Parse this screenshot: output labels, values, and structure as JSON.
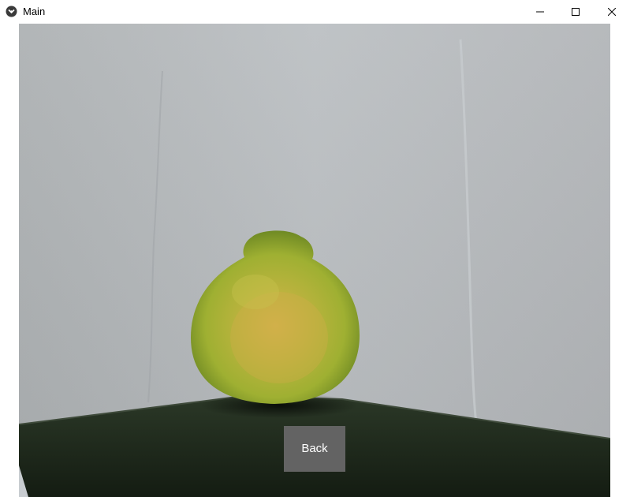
{
  "window": {
    "title": "Main",
    "icon": "kivy-app-icon",
    "controls": [
      "minimize-icon",
      "maximize-icon",
      "close-icon"
    ]
  },
  "camera": {
    "subject": "lime-fruit"
  },
  "back_button": {
    "label": "Back"
  },
  "colors": {
    "button_bg": "#636363",
    "button_text": "#ffffff",
    "wall": "#b9bdc0",
    "table": "#1e2a1c",
    "fruit": "#b5c23a"
  }
}
